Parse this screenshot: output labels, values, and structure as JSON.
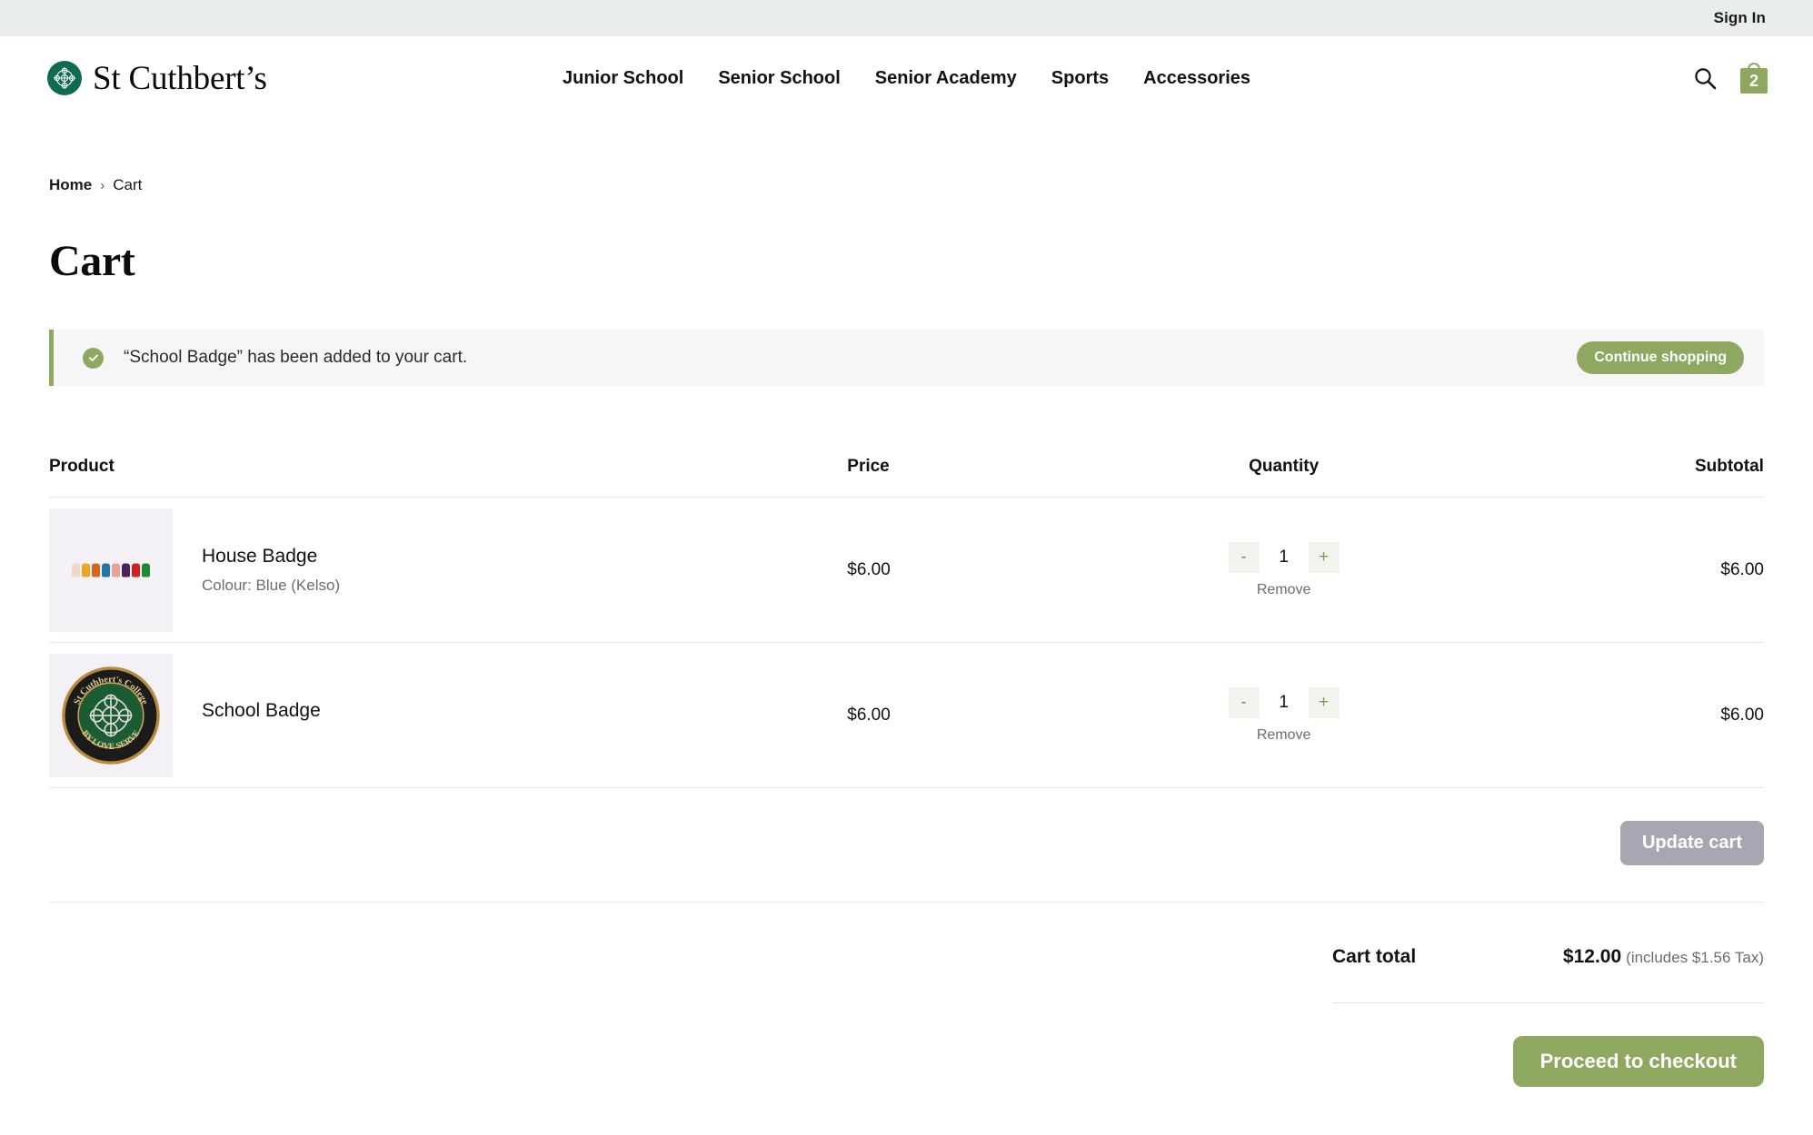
{
  "topbar": {
    "sign_in_label": "Sign In"
  },
  "header": {
    "brand_name": "St Cuthbert’s",
    "logo_icon": "celtic-cross-logo",
    "nav": [
      {
        "label": "Junior School"
      },
      {
        "label": "Senior School"
      },
      {
        "label": "Senior Academy"
      },
      {
        "label": "Sports"
      },
      {
        "label": "Accessories"
      }
    ],
    "search_icon": "search-icon",
    "cart_icon": "shopping-bag-icon",
    "cart_count": "2"
  },
  "breadcrumb": {
    "home": "Home",
    "separator": "›",
    "current": "Cart"
  },
  "page": {
    "title": "Cart"
  },
  "notice": {
    "icon": "check-circle-icon",
    "message": "“School Badge” has been added to your cart.",
    "button_label": "Continue shopping",
    "accent_color": "#8fa860",
    "background_color": "#f6f6f6"
  },
  "cart_table": {
    "headers": {
      "product": "Product",
      "price": "Price",
      "quantity": "Quantity",
      "subtotal": "Subtotal"
    },
    "items": [
      {
        "name": "House Badge",
        "variant": "Colour: Blue (Kelso)",
        "price": "$6.00",
        "quantity": "1",
        "subtotal": "$6.00",
        "decrement_label": "-",
        "increment_label": "+",
        "remove_label": "Remove",
        "thumbnail": "house-badge-colour-row-thumbnail",
        "thumbnail_colors": [
          "#efd9c4",
          "#e8a920",
          "#d4671f",
          "#1f76a8",
          "#ef9e9e",
          "#4a2359",
          "#cf2222",
          "#1f8a33"
        ]
      },
      {
        "name": "School Badge",
        "variant": "",
        "price": "$6.00",
        "quantity": "1",
        "subtotal": "$6.00",
        "decrement_label": "-",
        "increment_label": "+",
        "remove_label": "Remove",
        "thumbnail": "school-badge-crest-thumbnail",
        "thumbnail_colors": [
          "#1c5c33",
          "#1b1b1b",
          "#b98a3c"
        ]
      }
    ]
  },
  "actions": {
    "update_cart_label": "Update cart",
    "update_cart_color": "#a9a6b3"
  },
  "totals": {
    "label": "Cart total",
    "amount": "$12.00",
    "tax_note": "(includes $1.56 Tax)",
    "checkout_label": "Proceed to checkout",
    "checkout_color": "#8fa860"
  }
}
